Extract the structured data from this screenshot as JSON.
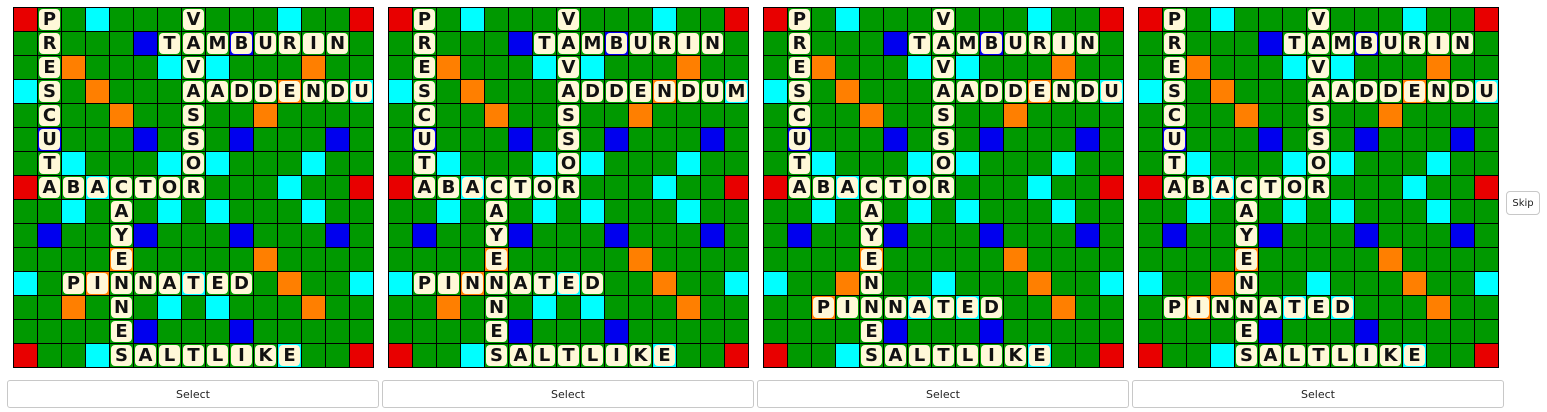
{
  "colors": {
    "grid_line": "#000000",
    "plain": "#009900",
    "triple_word": "#e80000",
    "double_word": "#ff7f00",
    "triple_letter": "#0000ee",
    "double_letter": "#00ffff",
    "tile": "#fff8d8",
    "tile_text": "#111111"
  },
  "premium_layout": {
    "tw": [
      [
        0,
        0
      ],
      [
        0,
        14
      ],
      [
        7,
        0
      ],
      [
        7,
        14
      ],
      [
        14,
        0
      ],
      [
        14,
        14
      ]
    ],
    "dw": [
      [
        2,
        2
      ],
      [
        3,
        3
      ],
      [
        4,
        4
      ],
      [
        2,
        12
      ],
      [
        3,
        11
      ],
      [
        4,
        10
      ],
      [
        10,
        10
      ],
      [
        11,
        11
      ],
      [
        12,
        12
      ],
      [
        10,
        4
      ],
      [
        11,
        3
      ],
      [
        12,
        2
      ]
    ],
    "tl": [
      [
        1,
        5
      ],
      [
        1,
        9
      ],
      [
        5,
        1
      ],
      [
        5,
        5
      ],
      [
        5,
        9
      ],
      [
        5,
        13
      ],
      [
        9,
        1
      ],
      [
        9,
        5
      ],
      [
        9,
        9
      ],
      [
        9,
        13
      ],
      [
        13,
        5
      ],
      [
        13,
        9
      ]
    ],
    "dl": [
      [
        0,
        3
      ],
      [
        0,
        11
      ],
      [
        2,
        6
      ],
      [
        2,
        8
      ],
      [
        3,
        0
      ],
      [
        3,
        14
      ],
      [
        6,
        2
      ],
      [
        6,
        6
      ],
      [
        6,
        8
      ],
      [
        6,
        12
      ],
      [
        7,
        3
      ],
      [
        7,
        11
      ],
      [
        8,
        2
      ],
      [
        8,
        6
      ],
      [
        8,
        8
      ],
      [
        8,
        12
      ],
      [
        11,
        0
      ],
      [
        11,
        7
      ],
      [
        11,
        14
      ],
      [
        12,
        6
      ],
      [
        12,
        8
      ],
      [
        14,
        3
      ],
      [
        14,
        11
      ]
    ]
  },
  "boards": [
    {
      "words": [
        {
          "word": "PRESCUTA",
          "row": 0,
          "col": 1,
          "dir": "down"
        },
        {
          "word": "VAVASSOR",
          "row": 0,
          "col": 7,
          "dir": "down"
        },
        {
          "word": "TAMBURIN",
          "row": 1,
          "col": 6,
          "dir": "across"
        },
        {
          "word": "ADDENDUM",
          "row": 3,
          "col": 8,
          "dir": "across"
        },
        {
          "word": "ABACTOR",
          "row": 7,
          "col": 1,
          "dir": "across"
        },
        {
          "word": "CAYENNE",
          "row": 7,
          "col": 4,
          "dir": "down"
        },
        {
          "word": "PINNATED",
          "row": 11,
          "col": 2,
          "dir": "across"
        },
        {
          "word": "SALTLIKE",
          "row": 14,
          "col": 4,
          "dir": "across"
        }
      ]
    },
    {
      "words": [
        {
          "word": "PRESCUTA",
          "row": 0,
          "col": 1,
          "dir": "down"
        },
        {
          "word": "VAVASSOR",
          "row": 0,
          "col": 7,
          "dir": "down"
        },
        {
          "word": "TAMBURIN",
          "row": 1,
          "col": 6,
          "dir": "across"
        },
        {
          "word": "ADDENDUM",
          "row": 3,
          "col": 7,
          "dir": "across"
        },
        {
          "word": "ABACTOR",
          "row": 7,
          "col": 1,
          "dir": "across"
        },
        {
          "word": "CAYENNE",
          "row": 7,
          "col": 4,
          "dir": "down"
        },
        {
          "word": "PINNATED",
          "row": 11,
          "col": 1,
          "dir": "across"
        },
        {
          "word": "SALTLIKE",
          "row": 14,
          "col": 4,
          "dir": "across"
        }
      ]
    },
    {
      "words": [
        {
          "word": "PRESCUTA",
          "row": 0,
          "col": 1,
          "dir": "down"
        },
        {
          "word": "VAVASSOR",
          "row": 0,
          "col": 7,
          "dir": "down"
        },
        {
          "word": "TAMBURIN",
          "row": 1,
          "col": 6,
          "dir": "across"
        },
        {
          "word": "ADDENDUM",
          "row": 3,
          "col": 8,
          "dir": "across"
        },
        {
          "word": "ABACTOR",
          "row": 7,
          "col": 1,
          "dir": "across"
        },
        {
          "word": "CAYENNES",
          "row": 7,
          "col": 4,
          "dir": "down"
        },
        {
          "word": "PINNATED",
          "row": 12,
          "col": 2,
          "dir": "across"
        },
        {
          "word": "SALTLIKE",
          "row": 14,
          "col": 4,
          "dir": "across"
        }
      ]
    },
    {
      "words": [
        {
          "word": "PRESCUTA",
          "row": 0,
          "col": 1,
          "dir": "down"
        },
        {
          "word": "VAVASSOR",
          "row": 0,
          "col": 7,
          "dir": "down"
        },
        {
          "word": "TAMBURIN",
          "row": 1,
          "col": 6,
          "dir": "across"
        },
        {
          "word": "ADDENDUM",
          "row": 3,
          "col": 8,
          "dir": "across"
        },
        {
          "word": "ABACTOR",
          "row": 7,
          "col": 1,
          "dir": "across"
        },
        {
          "word": "CAYENNES",
          "row": 7,
          "col": 4,
          "dir": "down"
        },
        {
          "word": "PINNATED",
          "row": 12,
          "col": 1,
          "dir": "across"
        },
        {
          "word": "SALTLIKE",
          "row": 14,
          "col": 4,
          "dir": "across"
        }
      ]
    }
  ],
  "buttons": {
    "select_label": "Select",
    "skip_label": "Skip"
  }
}
